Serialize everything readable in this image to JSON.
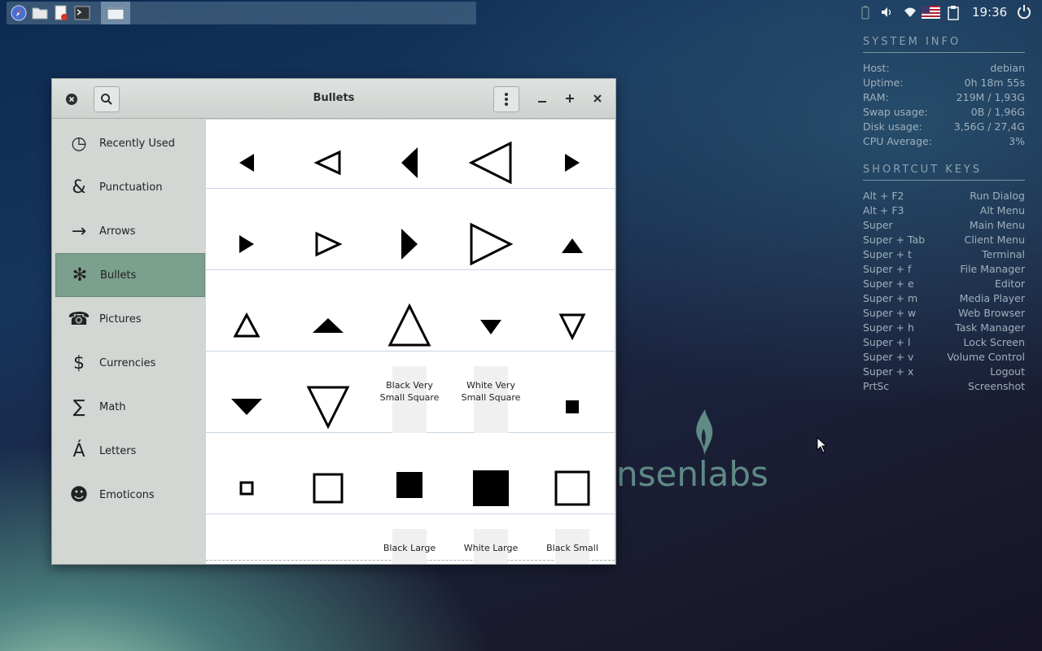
{
  "taskbar": {
    "launchers": [
      {
        "icon": "compass-icon"
      },
      {
        "icon": "folder-icon"
      },
      {
        "icon": "text-editor-icon"
      },
      {
        "icon": "terminal-icon"
      }
    ],
    "active_window_icon": "window-icon",
    "tray_icons": [
      "battery-icon",
      "volume-icon",
      "wifi-icon",
      "us-flag-icon",
      "clipboard-icon"
    ],
    "clock": "19:36",
    "power_icon": "power-icon"
  },
  "conky": {
    "system_info_title": "SYSTEM INFO",
    "system_rows": [
      {
        "label": "Host:",
        "value": "debian"
      },
      {
        "label": "Uptime:",
        "value": "0h 18m 55s"
      },
      {
        "label": "RAM:",
        "value": "219M / 1,93G"
      },
      {
        "label": "Swap usage:",
        "value": "0B / 1,96G"
      },
      {
        "label": "Disk usage:",
        "value": "3,56G / 27,4G"
      },
      {
        "label": "CPU Average:",
        "value": "3%"
      }
    ],
    "shortcuts_title": "SHORTCUT KEYS",
    "shortcut_rows": [
      {
        "label": "Alt + F2",
        "value": "Run Dialog"
      },
      {
        "label": "Alt + F3",
        "value": "Alt Menu"
      },
      {
        "label": "Super",
        "value": "Main Menu"
      },
      {
        "label": "Super + Tab",
        "value": "Client Menu"
      },
      {
        "label": "Super + t",
        "value": "Terminal"
      },
      {
        "label": "Super + f",
        "value": "File Manager"
      },
      {
        "label": "Super + e",
        "value": "Editor"
      },
      {
        "label": "Super + m",
        "value": "Media Player"
      },
      {
        "label": "Super + w",
        "value": "Web Browser"
      },
      {
        "label": "Super + h",
        "value": "Task Manager"
      },
      {
        "label": "Super + l",
        "value": "Lock Screen"
      },
      {
        "label": "Super + v",
        "value": "Volume Control"
      },
      {
        "label": "Super + x",
        "value": "Logout"
      },
      {
        "label": "PrtSc",
        "value": "Screenshot"
      }
    ]
  },
  "wallpaper": {
    "logo_text": "nsenlabs"
  },
  "window": {
    "title": "Bullets",
    "categories": [
      {
        "label": "Recently Used",
        "icon": "clock-icon",
        "glyph": "◷"
      },
      {
        "label": "Punctuation",
        "icon": "ampersand-icon",
        "glyph": "&"
      },
      {
        "label": "Arrows",
        "icon": "arrow-icon",
        "glyph": "→"
      },
      {
        "label": "Bullets",
        "icon": "bullet-icon",
        "glyph": "✻",
        "selected": true
      },
      {
        "label": "Pictures",
        "icon": "telephone-icon",
        "glyph": "☎"
      },
      {
        "label": "Currencies",
        "icon": "dollar-icon",
        "glyph": "$"
      },
      {
        "label": "Math",
        "icon": "sigma-icon",
        "glyph": "∑"
      },
      {
        "label": "Letters",
        "icon": "letter-a-acute-icon",
        "glyph": "Á"
      },
      {
        "label": "Emoticons",
        "icon": "smiley-icon",
        "glyph": "☻"
      }
    ],
    "characters": [
      [
        {
          "shape": "tri-left-solid-small"
        },
        {
          "shape": "tri-left-outline-small"
        },
        {
          "shape": "tri-left-solid-mid"
        },
        {
          "shape": "tri-left-outline-large"
        },
        {
          "shape": "tri-right-solid-small"
        }
      ],
      [
        {
          "shape": "tri-right-solid-small"
        },
        {
          "shape": "tri-right-outline-small"
        },
        {
          "shape": "tri-right-solid-mid"
        },
        {
          "shape": "tri-right-outline-large"
        },
        {
          "shape": "tri-up-solid-small"
        }
      ],
      [
        {
          "shape": "tri-up-outline-small"
        },
        {
          "shape": "tri-up-solid-wide"
        },
        {
          "shape": "tri-up-outline-large"
        },
        {
          "shape": "tri-down-solid-small"
        },
        {
          "shape": "tri-down-outline-small"
        }
      ],
      [
        {
          "shape": "tri-down-solid-wide"
        },
        {
          "shape": "tri-down-outline-large"
        },
        {
          "shape": "name",
          "name_lines": [
            "Black Very",
            "Small Square"
          ]
        },
        {
          "shape": "name",
          "name_lines": [
            "White Very",
            "Small Square"
          ]
        },
        {
          "shape": "sq-solid-small"
        }
      ],
      [
        {
          "shape": "sq-outline-small"
        },
        {
          "shape": "sq-outline-mid"
        },
        {
          "shape": "sq-solid-mid"
        },
        {
          "shape": "sq-solid-large"
        },
        {
          "shape": "sq-outline-large"
        }
      ],
      [
        {
          "shape": "empty"
        },
        {
          "shape": "empty"
        },
        {
          "shape": "name",
          "name_lines": [
            "Black Large",
            ""
          ]
        },
        {
          "shape": "name",
          "name_lines": [
            "White Large",
            ""
          ]
        },
        {
          "shape": "name",
          "name_lines": [
            "Black Small",
            ""
          ]
        }
      ]
    ]
  }
}
